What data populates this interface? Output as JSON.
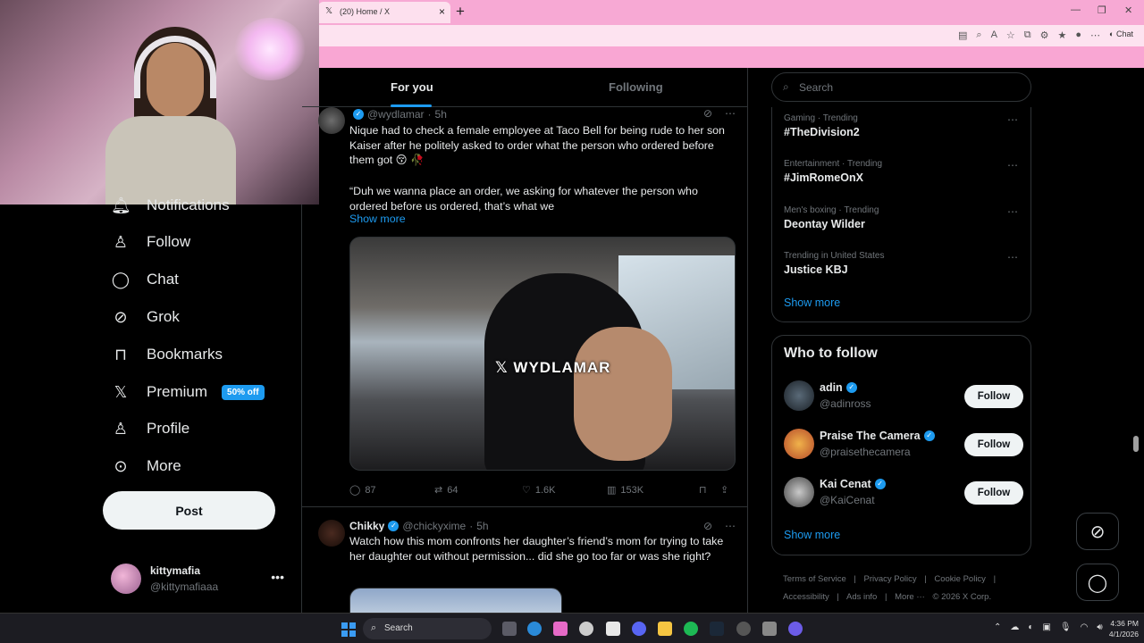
{
  "browser": {
    "tab_title": "(20) Home / X",
    "tab_close": "×",
    "new_tab": "+",
    "chat_label": "Chat"
  },
  "nav": {
    "items": [
      {
        "label": "Notifications",
        "icon": "bell-icon"
      },
      {
        "label": "Follow",
        "icon": "person-plus-icon"
      },
      {
        "label": "Chat",
        "icon": "chat-bubble-icon"
      },
      {
        "label": "Grok",
        "icon": "grok-icon"
      },
      {
        "label": "Bookmarks",
        "icon": "bookmark-icon"
      },
      {
        "label": "Premium",
        "icon": "x-logo-icon",
        "badge": "50% off"
      },
      {
        "label": "Profile",
        "icon": "person-icon"
      },
      {
        "label": "More",
        "icon": "more-circle-icon"
      }
    ],
    "post_label": "Post",
    "account": {
      "name": "kittymafia",
      "handle": "@kittymafiaaa"
    }
  },
  "feed": {
    "tabs": [
      "For you",
      "Following"
    ],
    "tweet1": {
      "name": "",
      "handle": "@wydlamar",
      "time": "5h",
      "text1": "Nique had to check a female employee at Taco Bell for being rude to her son Kaiser after he politely asked to order what the person who ordered before them got 😚 🥀",
      "text2": "“Duh we wanna place an order, we asking for whatever the person who ordered before us ordered, that’s what we",
      "show_more": "Show more",
      "watermark": "WYDLAMAR",
      "replies": "87",
      "reposts": "64",
      "likes": "1.6K",
      "views": "153K"
    },
    "tweet2": {
      "name": "Chikky",
      "handle": "@chickyxime",
      "time": "5h",
      "text": "Watch how this mom confronts her daughter’s friend’s mom for trying to take her daughter out without permission... did she go too far or was she right?"
    }
  },
  "sidebar": {
    "search_placeholder": "Search",
    "trends": [
      {
        "category": "Gaming · Trending",
        "name": "#TheDivision2"
      },
      {
        "category": "Entertainment · Trending",
        "name": "#JimRomeOnX"
      },
      {
        "category": "Men's boxing · Trending",
        "name": "Deontay Wilder"
      },
      {
        "category": "Trending in United States",
        "name": "Justice KBJ"
      }
    ],
    "show_more": "Show more",
    "who_to_follow": {
      "title": "Who to follow",
      "users": [
        {
          "name": "adin",
          "handle": "@adinross"
        },
        {
          "name": "Praise The Camera",
          "handle": "@praisethecamera"
        },
        {
          "name": "Kai Cenat",
          "handle": "@KaiCenat"
        }
      ],
      "follow_label": "Follow",
      "show_more": "Show more"
    },
    "footer": [
      "Terms of Service",
      "|",
      "Privacy Policy",
      "|",
      "Cookie Policy",
      "|",
      "Accessibility",
      "|",
      "Ads info",
      "|",
      "More ···",
      "© 2026 X Corp."
    ]
  },
  "taskbar": {
    "search": "Search",
    "time": "4:36 PM",
    "date": "4/1/2026"
  }
}
